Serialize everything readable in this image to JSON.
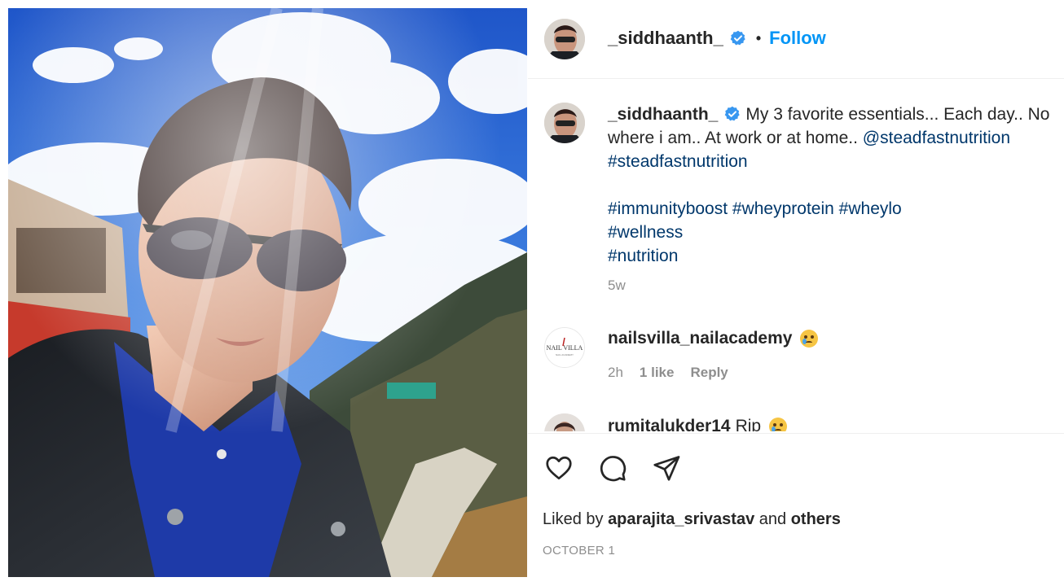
{
  "post": {
    "username": "_siddhaanth_",
    "separator": "•",
    "follow_label": "Follow",
    "verified_icon": "verified-badge-icon"
  },
  "caption": {
    "username": "_siddhaanth_",
    "line1": "My 3 favorite essentials... Each day.. No",
    "line2_text": "where i am.. At work or at home.. ",
    "line2_mention": "@steadfastnutrition",
    "line3": "#steadfastnutrition",
    "hashtags_line1": [
      "#immunityboost",
      "#wheyprotein",
      "#wheylo"
    ],
    "hashtags_line2": "#wellness",
    "hashtags_line3": "#nutrition",
    "age": "5w"
  },
  "comments": [
    {
      "username": "nailsvilla_nailacademy",
      "text": "",
      "emoji": "crying-face-emoji",
      "age": "2h",
      "likes": "1 like",
      "reply_label": "Reply",
      "avatar_text": "NAIL VILLA"
    },
    {
      "username": "rumitalukder14",
      "text": "Rip",
      "emoji": "crying-face-emoji"
    }
  ],
  "actions": {
    "like_icon": "heart-icon",
    "comment_icon": "comment-icon",
    "share_icon": "send-icon"
  },
  "likes": {
    "prefix": "Liked by",
    "user": "aparajita_srivastav",
    "and": "and",
    "others": "others"
  },
  "date": "OCTOBER 1",
  "colors": {
    "follow_blue": "#0095f6",
    "link_blue": "#00376b",
    "muted_gray": "#8e8e8e",
    "text": "#262626"
  }
}
